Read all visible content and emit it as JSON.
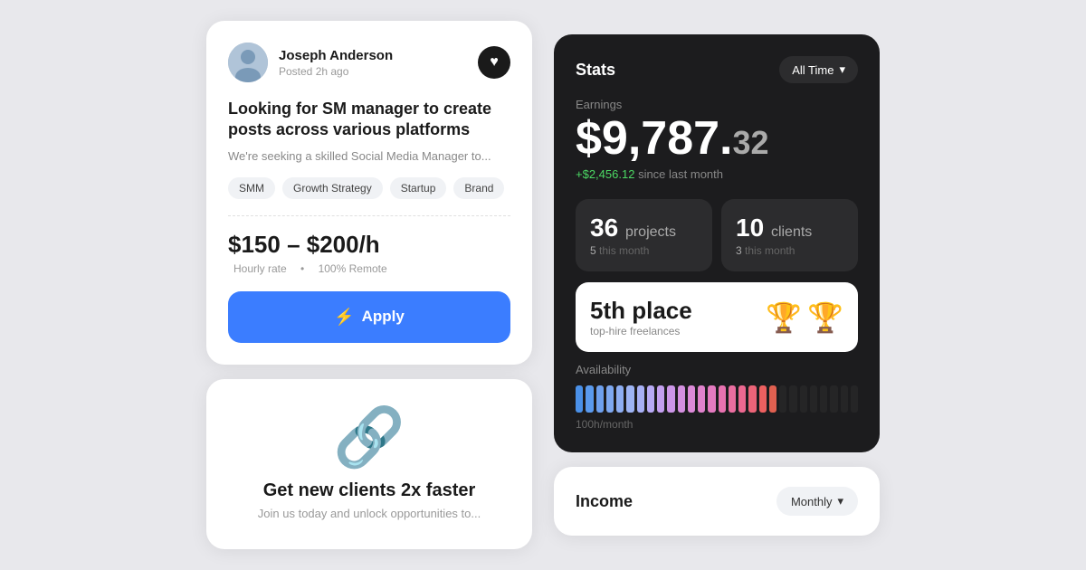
{
  "job_card": {
    "user_name": "Joseph Anderson",
    "posted_time": "Posted 2h ago",
    "title": "Looking for SM manager to create posts across various platforms",
    "description": "We're seeking a skilled Social Media Manager to...",
    "tags": [
      "SMM",
      "Growth Strategy",
      "Startup",
      "Brand"
    ],
    "rate": "$150 – $200/h",
    "rate_detail": "Hourly rate",
    "rate_remote": "100% Remote",
    "apply_label": "Apply"
  },
  "clients_card": {
    "title": "Get new clients 2x faster",
    "subtitle": "Join us today and unlock opportunities to..."
  },
  "stats_card": {
    "title": "Stats",
    "filter_label": "All Time",
    "earnings_label": "Earnings",
    "earnings_main": "$9,787.",
    "earnings_cents": "32",
    "since_amount": "+$2,456.12",
    "since_label": "since last month",
    "projects_count": "36",
    "projects_label": "projects",
    "projects_sub": "5",
    "projects_sub_label": "this month",
    "clients_count": "10",
    "clients_label": "clients",
    "clients_sub": "3",
    "clients_sub_label": "this month",
    "rank_place": "5th place",
    "rank_desc": "top-hire freelances",
    "availability_label": "Availability",
    "avail_sub": "100h/month"
  },
  "income_card": {
    "title": "Income",
    "filter_label": "Monthly"
  },
  "bars": [
    {
      "color": "#4a90e8",
      "active": true
    },
    {
      "color": "#5a9aee",
      "active": true
    },
    {
      "color": "#6ea0ee",
      "active": true
    },
    {
      "color": "#7ea8f0",
      "active": true
    },
    {
      "color": "#8eaef2",
      "active": true
    },
    {
      "color": "#9eb4f4",
      "active": true
    },
    {
      "color": "#a8b0f5",
      "active": true
    },
    {
      "color": "#b8aaf5",
      "active": true
    },
    {
      "color": "#c4a0f0",
      "active": true
    },
    {
      "color": "#cc96e8",
      "active": true
    },
    {
      "color": "#d490e0",
      "active": true
    },
    {
      "color": "#dc8ad8",
      "active": true
    },
    {
      "color": "#e082cc",
      "active": true
    },
    {
      "color": "#e47ac0",
      "active": true
    },
    {
      "color": "#e872b0",
      "active": true
    },
    {
      "color": "#ea6ea0",
      "active": true
    },
    {
      "color": "#eb6890",
      "active": true
    },
    {
      "color": "#ec6478",
      "active": true
    },
    {
      "color": "#ed6060",
      "active": true
    },
    {
      "color": "#e06050",
      "active": true
    },
    {
      "color": "#3a3a3c",
      "active": false
    },
    {
      "color": "#3a3a3c",
      "active": false
    },
    {
      "color": "#3a3a3c",
      "active": false
    },
    {
      "color": "#3a3a3c",
      "active": false
    },
    {
      "color": "#3a3a3c",
      "active": false
    },
    {
      "color": "#3a3a3c",
      "active": false
    },
    {
      "color": "#3a3a3c",
      "active": false
    },
    {
      "color": "#3a3a3c",
      "active": false
    }
  ]
}
